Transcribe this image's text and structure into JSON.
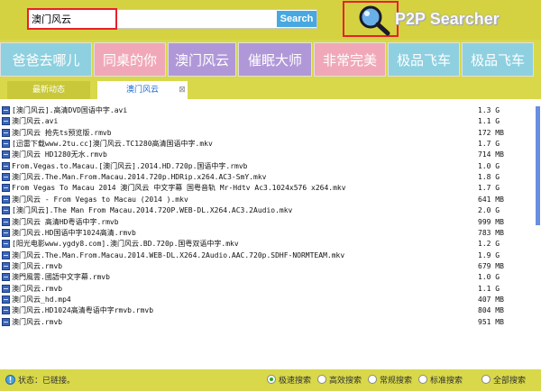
{
  "search": {
    "value": "澳门风云",
    "button_label": "Search"
  },
  "logo": {
    "text": "P2P Searcher"
  },
  "tags": [
    {
      "label": "爸爸去哪儿",
      "color": "#8ed0e0"
    },
    {
      "label": "同桌的你",
      "color": "#f0a8b8"
    },
    {
      "label": "澳门风云",
      "color": "#b098d8"
    },
    {
      "label": "催眠大师",
      "color": "#b098d8"
    },
    {
      "label": "非常完美",
      "color": "#f0a8b8"
    },
    {
      "label": "极品飞车",
      "color": "#8ed0e0"
    },
    {
      "label": "极品飞车",
      "color": "#8ed0e0"
    }
  ],
  "tabs": {
    "inactive_label": "最新动态",
    "active_label": "澳门风云",
    "close_glyph": "⊠"
  },
  "results": [
    {
      "name": "[澳门风云].高清DVD国语中字.avi",
      "size": "1.3 G"
    },
    {
      "name": "澳门风云.avi",
      "size": "1.1 G"
    },
    {
      "name": "澳门风云 抢先ts预览版.rmvb",
      "size": "172 MB"
    },
    {
      "name": "[迅雷下载www.2tu.cc]澳门风云.TC1280高清国语中字.mkv",
      "size": "1.7 G"
    },
    {
      "name": "澳门风云 HD1280无水.rmvb",
      "size": "714 MB"
    },
    {
      "name": "From.Vegas.to.Macau.[澳门风云].2014.HD.720p.国语中字.rmvb",
      "size": "1.0 G"
    },
    {
      "name": "澳门风云.The.Man.From.Macau.2014.720p.HDRip.x264.AC3-SmY.mkv",
      "size": "1.8 G"
    },
    {
      "name": "From Vegas To Macau 2014 澳门风云 中文字幕 国粤音轨 Mr-Hdtv Ac3.1024x576 x264.mkv",
      "size": "1.7 G"
    },
    {
      "name": "澳门风云 - From Vegas to Macau (2014 ).mkv",
      "size": "641 MB"
    },
    {
      "name": "[澳门风云].The Man From Macau.2014.720P.WEB-DL.X264.AC3.2Audio.mkv",
      "size": "2.0 G"
    },
    {
      "name": "澳门风云 高清HD粤语中字.rmvb",
      "size": "999 MB"
    },
    {
      "name": "澳门风云.HD国语中字1024高清.rmvb",
      "size": "783 MB"
    },
    {
      "name": "[阳光电影www.ygdy8.com].澳门风云.BD.720p.国粤双语中字.mkv",
      "size": "1.2 G"
    },
    {
      "name": "澳门风云.The.Man.From.Macau.2014.WEB-DL.X264.2Audio.AAC.720p.SDHF-NORMTEAM.mkv",
      "size": "1.9 G"
    },
    {
      "name": "澳门风云.rmvb",
      "size": "679 MB"
    },
    {
      "name": "澳門風雲.國語中文字幕.rmvb",
      "size": "1.0 G"
    },
    {
      "name": "澳门风云.rmvb",
      "size": "1.1 G"
    },
    {
      "name": "澳门风云_hd.mp4",
      "size": "407 MB"
    },
    {
      "name": "澳门风云.HD1024高清粤语中字rmvb.rmvb",
      "size": "804 MB"
    },
    {
      "name": "澳门风云.rmvb",
      "size": "951 MB"
    }
  ],
  "status": {
    "text": "状态：已链接。",
    "options": [
      {
        "label": "极速搜索",
        "selected": true
      },
      {
        "label": "高效搜索",
        "selected": false
      },
      {
        "label": "常规搜索",
        "selected": false
      },
      {
        "label": "标准搜索",
        "selected": false
      },
      {
        "label": "全部搜索",
        "selected": false
      }
    ]
  }
}
